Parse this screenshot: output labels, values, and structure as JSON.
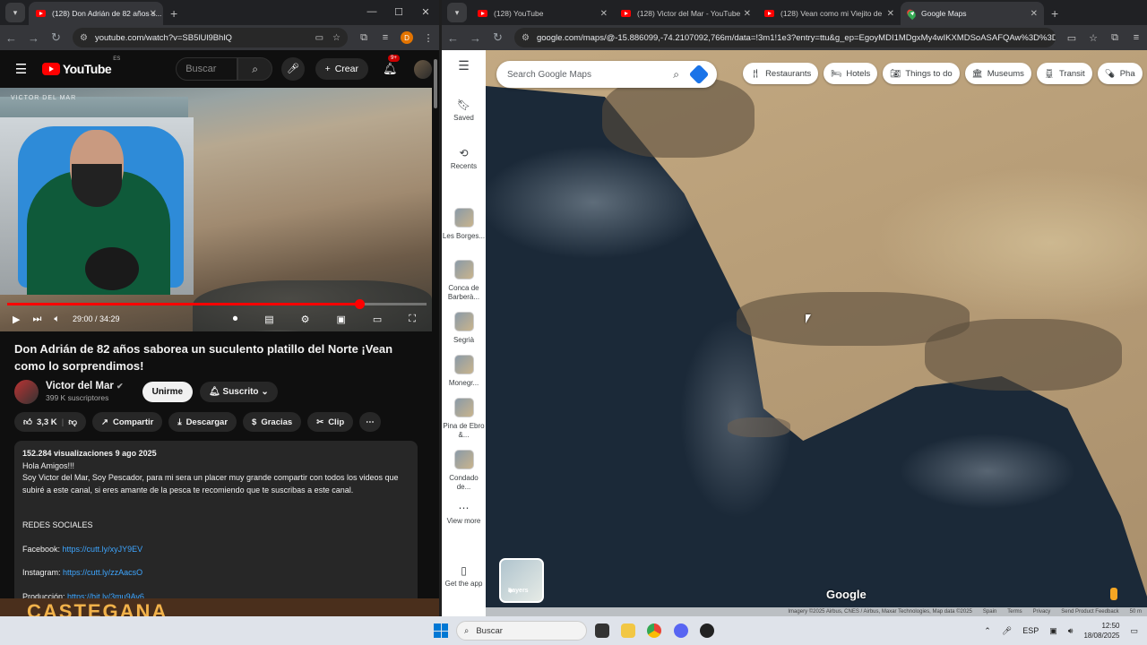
{
  "left_window": {
    "tabs": [
      {
        "title": "(128) Don Adrián de 82 años s..."
      }
    ],
    "url": "youtube.com/watch?v=SB5lUl9BhlQ",
    "profile_letter": "D",
    "youtube": {
      "logo_text": "YouTube",
      "region": "ES",
      "search_placeholder": "Buscar",
      "create_label": "Crear",
      "notif_badge": "9+",
      "watermark": "VICTOR DEL MAR",
      "time": "29:00 / 34:29",
      "progress_pct": 84,
      "video_title": "Don Adrián de 82 años saborea un suculento platillo del Norte ¡Vean como lo sorprendimos!",
      "channel_name": "Victor del Mar",
      "subscribers": "399 K suscriptores",
      "join_label": "Unirme",
      "subscribed_label": "Suscrito",
      "likes": "3,3 K",
      "share_label": "Compartir",
      "download_label": "Descargar",
      "thanks_label": "Gracias",
      "clip_label": "Clip",
      "desc_stats": "152.284 visualizaciones  9 ago 2025",
      "desc_lines": [
        "Hola Amigos!!!",
        "Soy Victor del Mar, Soy Pescador, para mi sera un placer muy grande compartir con todos los videos que subiré a este canal, si eres amante de la pesca te recomiendo que te suscribas a este canal."
      ],
      "social_heading": "REDES SOCIALES",
      "links": [
        {
          "label": "Facebook:",
          "url": "https://cutt.ly/xyJY9EV"
        },
        {
          "label": "Instagram:",
          "url": "https://cutt.ly/zzAacsO"
        },
        {
          "label": "Producción:",
          "url": "https://bit.ly/3mu9Av6"
        }
      ]
    }
  },
  "right_window": {
    "tabs": [
      {
        "title": "(128) YouTube"
      },
      {
        "title": "(128) Victor del Mar - YouTube"
      },
      {
        "title": "(128) Vean como mi Viejito de"
      },
      {
        "title": "Google Maps"
      }
    ],
    "url": "google.com/maps/@-15.886099,-74.2107092,766m/data=!3m1!1e3?entry=ttu&g_ep=EgoyMDI1MDgxMy4wIKXMDSoASAFQAw%3D%3D",
    "maps": {
      "search_placeholder": "Search Google Maps",
      "chips": [
        "Restaurants",
        "Hotels",
        "Things to do",
        "Museums",
        "Transit",
        "Pha"
      ],
      "sidebar": [
        {
          "label": "Saved",
          "icon": "bookmark-icon"
        },
        {
          "label": "Recents",
          "icon": "history-icon"
        },
        {
          "label": "Les Borges..."
        },
        {
          "label": "Conca de Barberà..."
        },
        {
          "label": "Segrià"
        },
        {
          "label": "Monegr..."
        },
        {
          "label": "Pina de Ebro &..."
        },
        {
          "label": "Condado de..."
        },
        {
          "label": "View more"
        },
        {
          "label": "Get the app"
        }
      ],
      "layers_label": "Layers",
      "google_logo": "Google",
      "attribution": "Imagery ©2025 Airbus, CNES / Airbus, Maxar Technologies, Map data ©2025",
      "footer_links": [
        "Spain",
        "Terms",
        "Privacy",
        "Send Product Feedback",
        "50 m"
      ]
    }
  },
  "taskbar": {
    "search_placeholder": "Buscar",
    "lang": "ESP",
    "time": "12:50",
    "date": "18/08/2025",
    "strip_text": "CASTEGANA"
  }
}
